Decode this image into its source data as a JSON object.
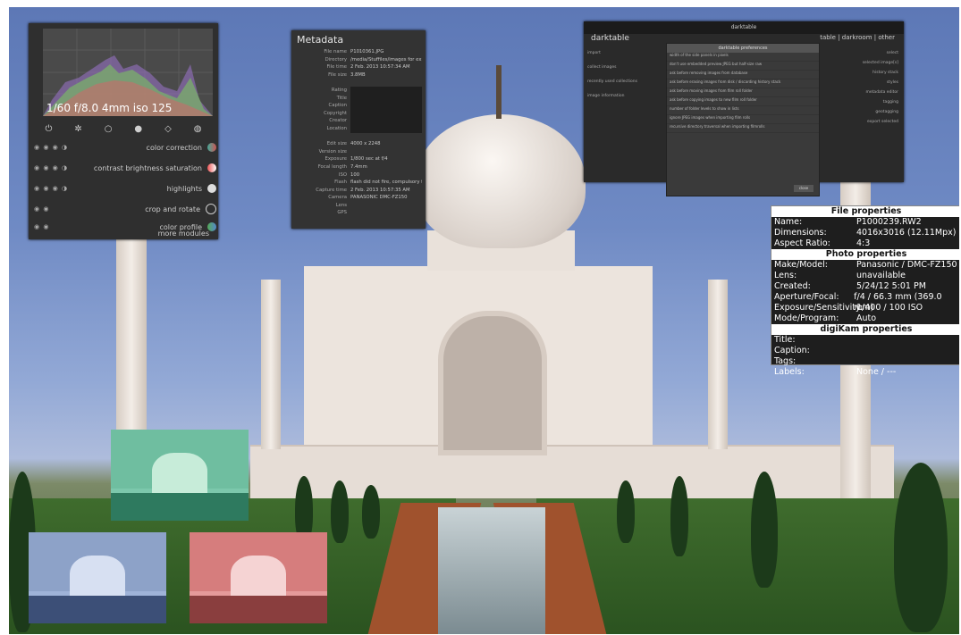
{
  "colors": {
    "panel_bg": "#2f2f2f",
    "thumb_green": "#4fa88a",
    "thumb_blue": "#8da2c8",
    "thumb_red": "#d67d7d"
  },
  "darkroom_panel": {
    "histogram_caption": "1/60 f/8.0 4mm iso 125",
    "module_group_icons": [
      "power-icon",
      "star-icon",
      "circle-icon",
      "color-icon",
      "shape-icon",
      "effect-icon"
    ],
    "modules": [
      {
        "label": "color correction",
        "icon": "color-wheel-icon"
      },
      {
        "label": "contrast brightness saturation",
        "icon": "contrast-icon"
      },
      {
        "label": "highlights",
        "icon": "highlights-icon"
      },
      {
        "label": "crop and rotate",
        "icon": "crop-icon"
      },
      {
        "label": "color profile",
        "icon": "profile-icon"
      }
    ],
    "more_modules": "more modules"
  },
  "metadata_panel": {
    "title": "Metadata",
    "rows": [
      {
        "k": "File name",
        "v": "P1010361.JPG"
      },
      {
        "k": "Directory",
        "v": "/media/Stuffiles/images for experim"
      },
      {
        "k": "File time",
        "v": "2 Feb. 2013 10:57:34 AM"
      },
      {
        "k": "File size",
        "v": "3.8MB"
      },
      {
        "k": "",
        "v": ""
      },
      {
        "k": "Rating",
        "v": "",
        "box": true
      },
      {
        "k": "Title",
        "v": "",
        "box": true
      },
      {
        "k": "Caption",
        "v": "",
        "box": true
      },
      {
        "k": "Copyright",
        "v": "",
        "box": true
      },
      {
        "k": "Creator",
        "v": "",
        "box": true
      },
      {
        "k": "Location",
        "v": "",
        "box": true
      },
      {
        "k": "",
        "v": ""
      },
      {
        "k": "Edit size",
        "v": "4000 x 2248"
      },
      {
        "k": "Version size",
        "v": ""
      },
      {
        "k": "Exposure",
        "v": "1/800 sec at f/4"
      },
      {
        "k": "Focal length",
        "v": "7.4mm"
      },
      {
        "k": "ISO",
        "v": "100"
      },
      {
        "k": "Flash",
        "v": "flash did not fire, compulsory flash m"
      },
      {
        "k": "Capture time",
        "v": "2 Feb. 2013 10:57:35 AM"
      },
      {
        "k": "Camera",
        "v": "PANASONIC DMC-FZ150"
      },
      {
        "k": "Lens",
        "v": ""
      },
      {
        "k": "GPS",
        "v": ""
      }
    ]
  },
  "darktable_window": {
    "title": "darktable",
    "logo": "darktable",
    "views": "table | darkroom | other",
    "preferences_title": "darktable preferences",
    "pref_rows": [
      "width of the side panels in pixels",
      "don't use embedded preview JPEG but half-size raw",
      "ask before removing images from database",
      "ask before erasing images from disk / discarding history stack",
      "ask before moving images from film roll folder",
      "ask before copying images to new film roll folder",
      "number of folder levels to show in lists",
      "ignore JPEG images when importing film rolls",
      "recursive directory traversal when importing filmrolls"
    ],
    "close_label": "close",
    "left_sections": [
      "import",
      "collect images",
      "recently used collections",
      "image information"
    ],
    "right_sections": [
      "select",
      "selected image[s]",
      "history stack",
      "styles",
      "metadata editor",
      "tagging",
      "geotagging",
      "export selected"
    ]
  },
  "properties_panel": {
    "file_header": "File properties",
    "file_rows": [
      {
        "k": "Name:",
        "v": "P1000239.RW2"
      },
      {
        "k": "Dimensions:",
        "v": "4016x3016 (12.11Mpx)"
      },
      {
        "k": "Aspect Ratio:",
        "v": "4:3"
      }
    ],
    "photo_header": "Photo properties",
    "photo_rows": [
      {
        "k": "Make/Model:",
        "v": "Panasonic / DMC-FZ150"
      },
      {
        "k": "Lens:",
        "v": "unavailable"
      },
      {
        "k": "Created:",
        "v": "5/24/12 5:01 PM"
      },
      {
        "k": "Aperture/Focal:",
        "v": "f/4 / 66.3 mm (369.0 mm)"
      },
      {
        "k": "Exposure/Sensitivity:",
        "v": "1/400 / 100 ISO"
      },
      {
        "k": "Mode/Program:",
        "v": "Auto"
      }
    ],
    "dc_header": "digiKam properties",
    "dc_rows": [
      {
        "k": "Title:",
        "v": ""
      },
      {
        "k": "Caption:",
        "v": ""
      },
      {
        "k": "Tags:",
        "v": ""
      },
      {
        "k": "Labels:",
        "v": "None / ---"
      }
    ]
  }
}
